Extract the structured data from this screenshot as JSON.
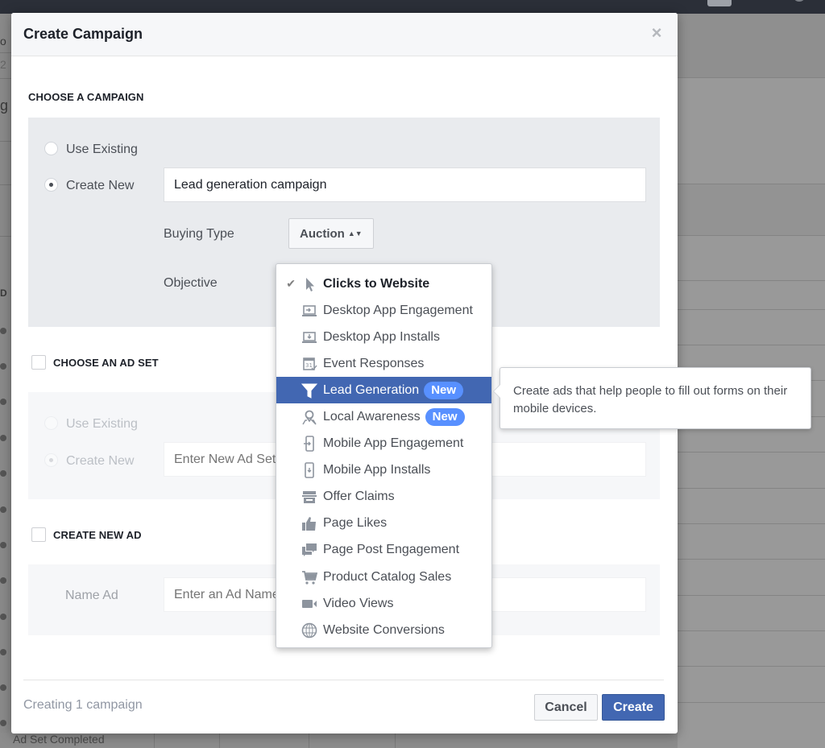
{
  "modal": {
    "title": "Create Campaign",
    "close_icon": "close-icon"
  },
  "campaign_section": {
    "title": "CHOOSE A CAMPAIGN",
    "use_existing_label": "Use Existing",
    "create_new_label": "Create New",
    "selected_option": "Create New",
    "campaign_name_value": "Lead generation campaign",
    "buying_type_label": "Buying Type",
    "buying_type_value": "Auction",
    "objective_label": "Objective"
  },
  "objective_dropdown": {
    "selected": "Clicks to Website",
    "highlighted": "Lead Generation",
    "items": [
      {
        "label": "Clicks to Website",
        "icon": "cursor-icon",
        "checked": true
      },
      {
        "label": "Desktop App Engagement",
        "icon": "desktop-engagement-icon"
      },
      {
        "label": "Desktop App Installs",
        "icon": "desktop-install-icon"
      },
      {
        "label": "Event Responses",
        "icon": "calendar-icon"
      },
      {
        "label": "Lead Generation",
        "icon": "funnel-icon",
        "badge": "New",
        "highlighted": true
      },
      {
        "label": "Local Awareness",
        "icon": "location-pin-icon",
        "badge": "New"
      },
      {
        "label": "Mobile App Engagement",
        "icon": "mobile-engagement-icon"
      },
      {
        "label": "Mobile App Installs",
        "icon": "mobile-install-icon"
      },
      {
        "label": "Offer Claims",
        "icon": "store-icon"
      },
      {
        "label": "Page Likes",
        "icon": "thumbs-up-icon"
      },
      {
        "label": "Page Post Engagement",
        "icon": "chat-bubbles-icon"
      },
      {
        "label": "Product Catalog Sales",
        "icon": "cart-icon"
      },
      {
        "label": "Video Views",
        "icon": "video-camera-icon"
      },
      {
        "label": "Website Conversions",
        "icon": "globe-icon"
      }
    ]
  },
  "tooltip": {
    "text": "Create ads that help people to fill out forms on their mobile devices."
  },
  "adset_section": {
    "title": "CHOOSE AN AD SET",
    "checked": false,
    "use_existing_label": "Use Existing",
    "create_new_label": "Create New",
    "adset_name_placeholder": "Enter New Ad Set Name"
  },
  "ad_section": {
    "title": "CREATE NEW AD",
    "checked": false,
    "name_label": "Name Ad",
    "ad_name_placeholder": "Enter an Ad Name"
  },
  "footer": {
    "status": "Creating 1 campaign",
    "cancel_label": "Cancel",
    "create_label": "Create"
  },
  "background": {
    "left_fragments": [
      "o",
      "2",
      "g",
      "D"
    ],
    "bottom_row_label": "Ad Set Completed"
  },
  "colors": {
    "primary": "#4267b2",
    "badge": "#5890ff",
    "header_bg": "#f6f7f9",
    "panel_bg": "#e9ebee"
  }
}
